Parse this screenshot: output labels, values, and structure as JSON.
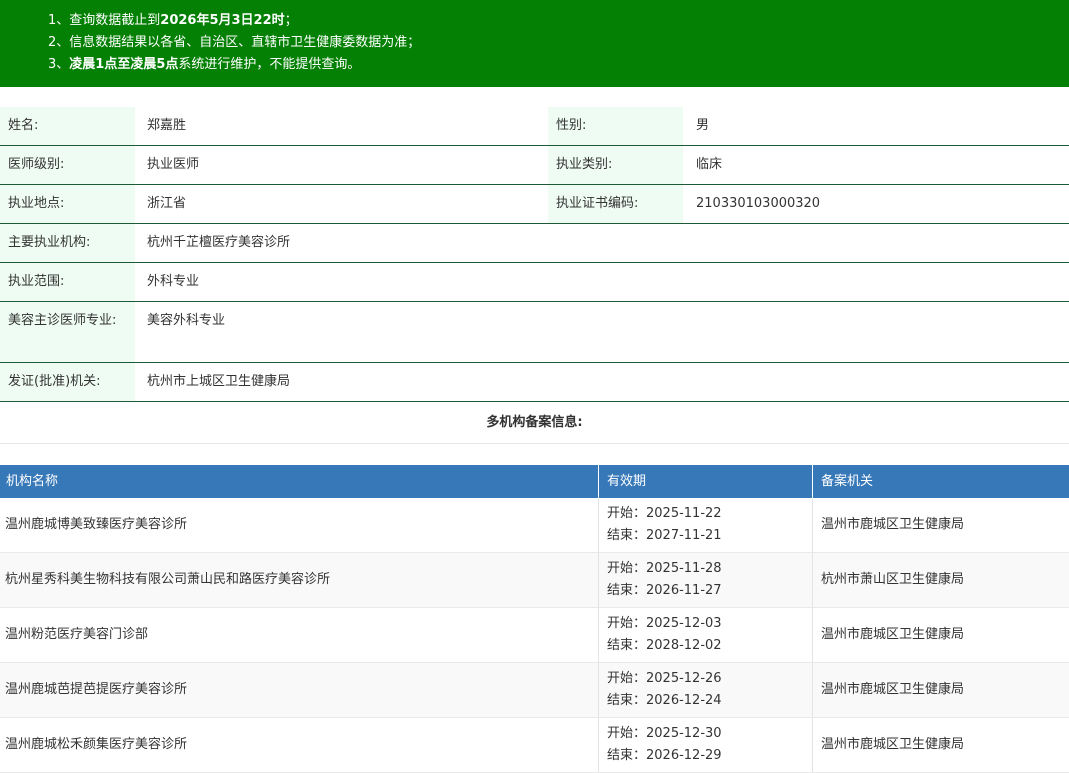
{
  "notice": {
    "line1_pre": "1、查询数据截止到",
    "line1_bold": "2026年5月3日22时",
    "line1_post": "；",
    "line2": "2、信息数据结果以各省、自治区、直辖市卫生健康委数据为准；",
    "line3_pre": "3、",
    "line3_bold": "凌晨1点至凌晨5点",
    "line3_post": "系统进行维护，不能提供查询。"
  },
  "info": {
    "name_label": "姓名:",
    "name": "郑嘉胜",
    "gender_label": "性别:",
    "gender": "男",
    "level_label": "医师级别:",
    "level": "执业医师",
    "category_label": "执业类别:",
    "category": "临床",
    "location_label": "执业地点:",
    "location": "浙江省",
    "cert_label": "执业证书编码:",
    "cert": "210330103000320",
    "org_label": "主要执业机构:",
    "org": "杭州千芷檀医疗美容诊所",
    "scope_label": "执业范围:",
    "scope": "外科专业",
    "cosmetic_label": "美容主诊医师专业:",
    "cosmetic": "美容外科专业",
    "issuer_label": "发证(批准)机关:",
    "issuer": "杭州市上城区卫生健康局"
  },
  "multi_title": "多机构备案信息:",
  "table": {
    "headers": [
      "机构名称",
      "有效期",
      "备案机关"
    ],
    "rows": [
      {
        "org": "温州鹿城博美致臻医疗美容诊所",
        "start": "开始：2025-11-22",
        "end": "结束：2027-11-21",
        "agency": "温州市鹿城区卫生健康局"
      },
      {
        "org": "杭州星秀科美生物科技有限公司萧山民和路医疗美容诊所",
        "start": "开始：2025-11-28",
        "end": "结束：2026-11-27",
        "agency": "杭州市萧山区卫生健康局"
      },
      {
        "org": "温州粉范医疗美容门诊部",
        "start": "开始：2025-12-03",
        "end": "结束：2028-12-02",
        "agency": "温州市鹿城区卫生健康局"
      },
      {
        "org": "温州鹿城芭提芭提医疗美容诊所",
        "start": "开始：2025-12-26",
        "end": "结束：2026-12-24",
        "agency": "温州市鹿城区卫生健康局"
      },
      {
        "org": "温州鹿城松禾颜集医疗美容诊所",
        "start": "开始：2025-12-30",
        "end": "结束：2026-12-29",
        "agency": "温州市鹿城区卫生健康局"
      }
    ]
  }
}
